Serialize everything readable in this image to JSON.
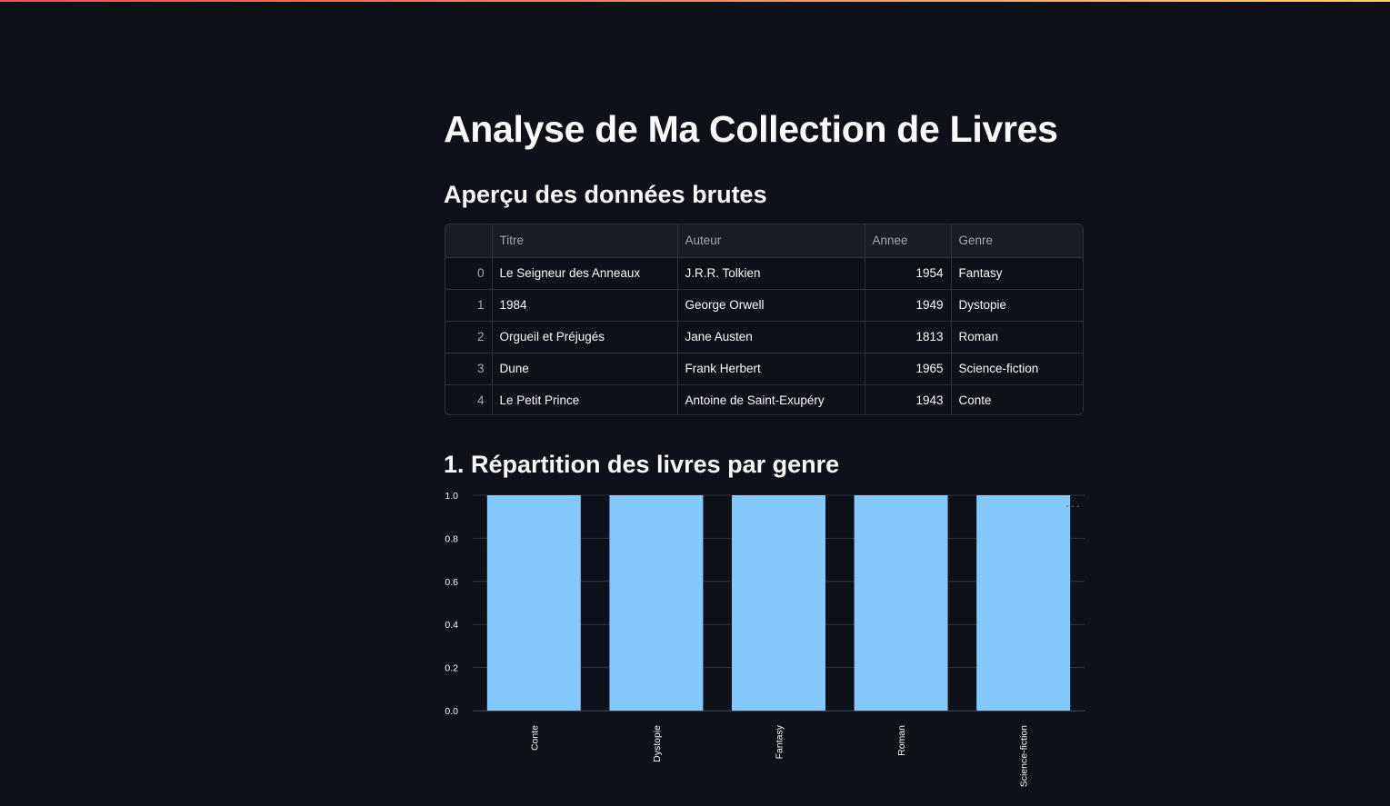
{
  "page": {
    "title": "Analyse de Ma Collection de Livres",
    "section1_title": "Aperçu des données brutes",
    "section2_title": "1. Répartition des livres par genre"
  },
  "table": {
    "columns": [
      "",
      "Titre",
      "Auteur",
      "Annee",
      "Genre"
    ],
    "rows": [
      {
        "index": "0",
        "titre": "Le Seigneur des Anneaux",
        "auteur": "J.R.R. Tolkien",
        "annee": "1954",
        "genre": "Fantasy"
      },
      {
        "index": "1",
        "titre": "1984",
        "auteur": "George Orwell",
        "annee": "1949",
        "genre": "Dystopie"
      },
      {
        "index": "2",
        "titre": "Orgueil et Préjugés",
        "auteur": "Jane Austen",
        "annee": "1813",
        "genre": "Roman"
      },
      {
        "index": "3",
        "titre": "Dune",
        "auteur": "Frank Herbert",
        "annee": "1965",
        "genre": "Science-fiction"
      },
      {
        "index": "4",
        "titre": "Le Petit Prince",
        "auteur": "Antoine de Saint-Exupéry",
        "annee": "1943",
        "genre": "Conte"
      }
    ]
  },
  "chart_menu": "···",
  "chart_data": {
    "type": "bar",
    "categories": [
      "Conte",
      "Dystopie",
      "Fantasy",
      "Roman",
      "Science-fiction"
    ],
    "values": [
      1,
      1,
      1,
      1,
      1
    ],
    "yticks": [
      "0.0",
      "0.2",
      "0.4",
      "0.6",
      "0.8",
      "1.0"
    ],
    "ylim": [
      0,
      1
    ],
    "grid": true,
    "bar_color": "#83c9ff",
    "grid_color": "#31333f"
  },
  "colors": {
    "background": "#0e1117",
    "text": "#fafafa",
    "muted_text": "#a3a8b4",
    "table_header_bg": "#1a1c24",
    "border": "#2b2f38"
  }
}
